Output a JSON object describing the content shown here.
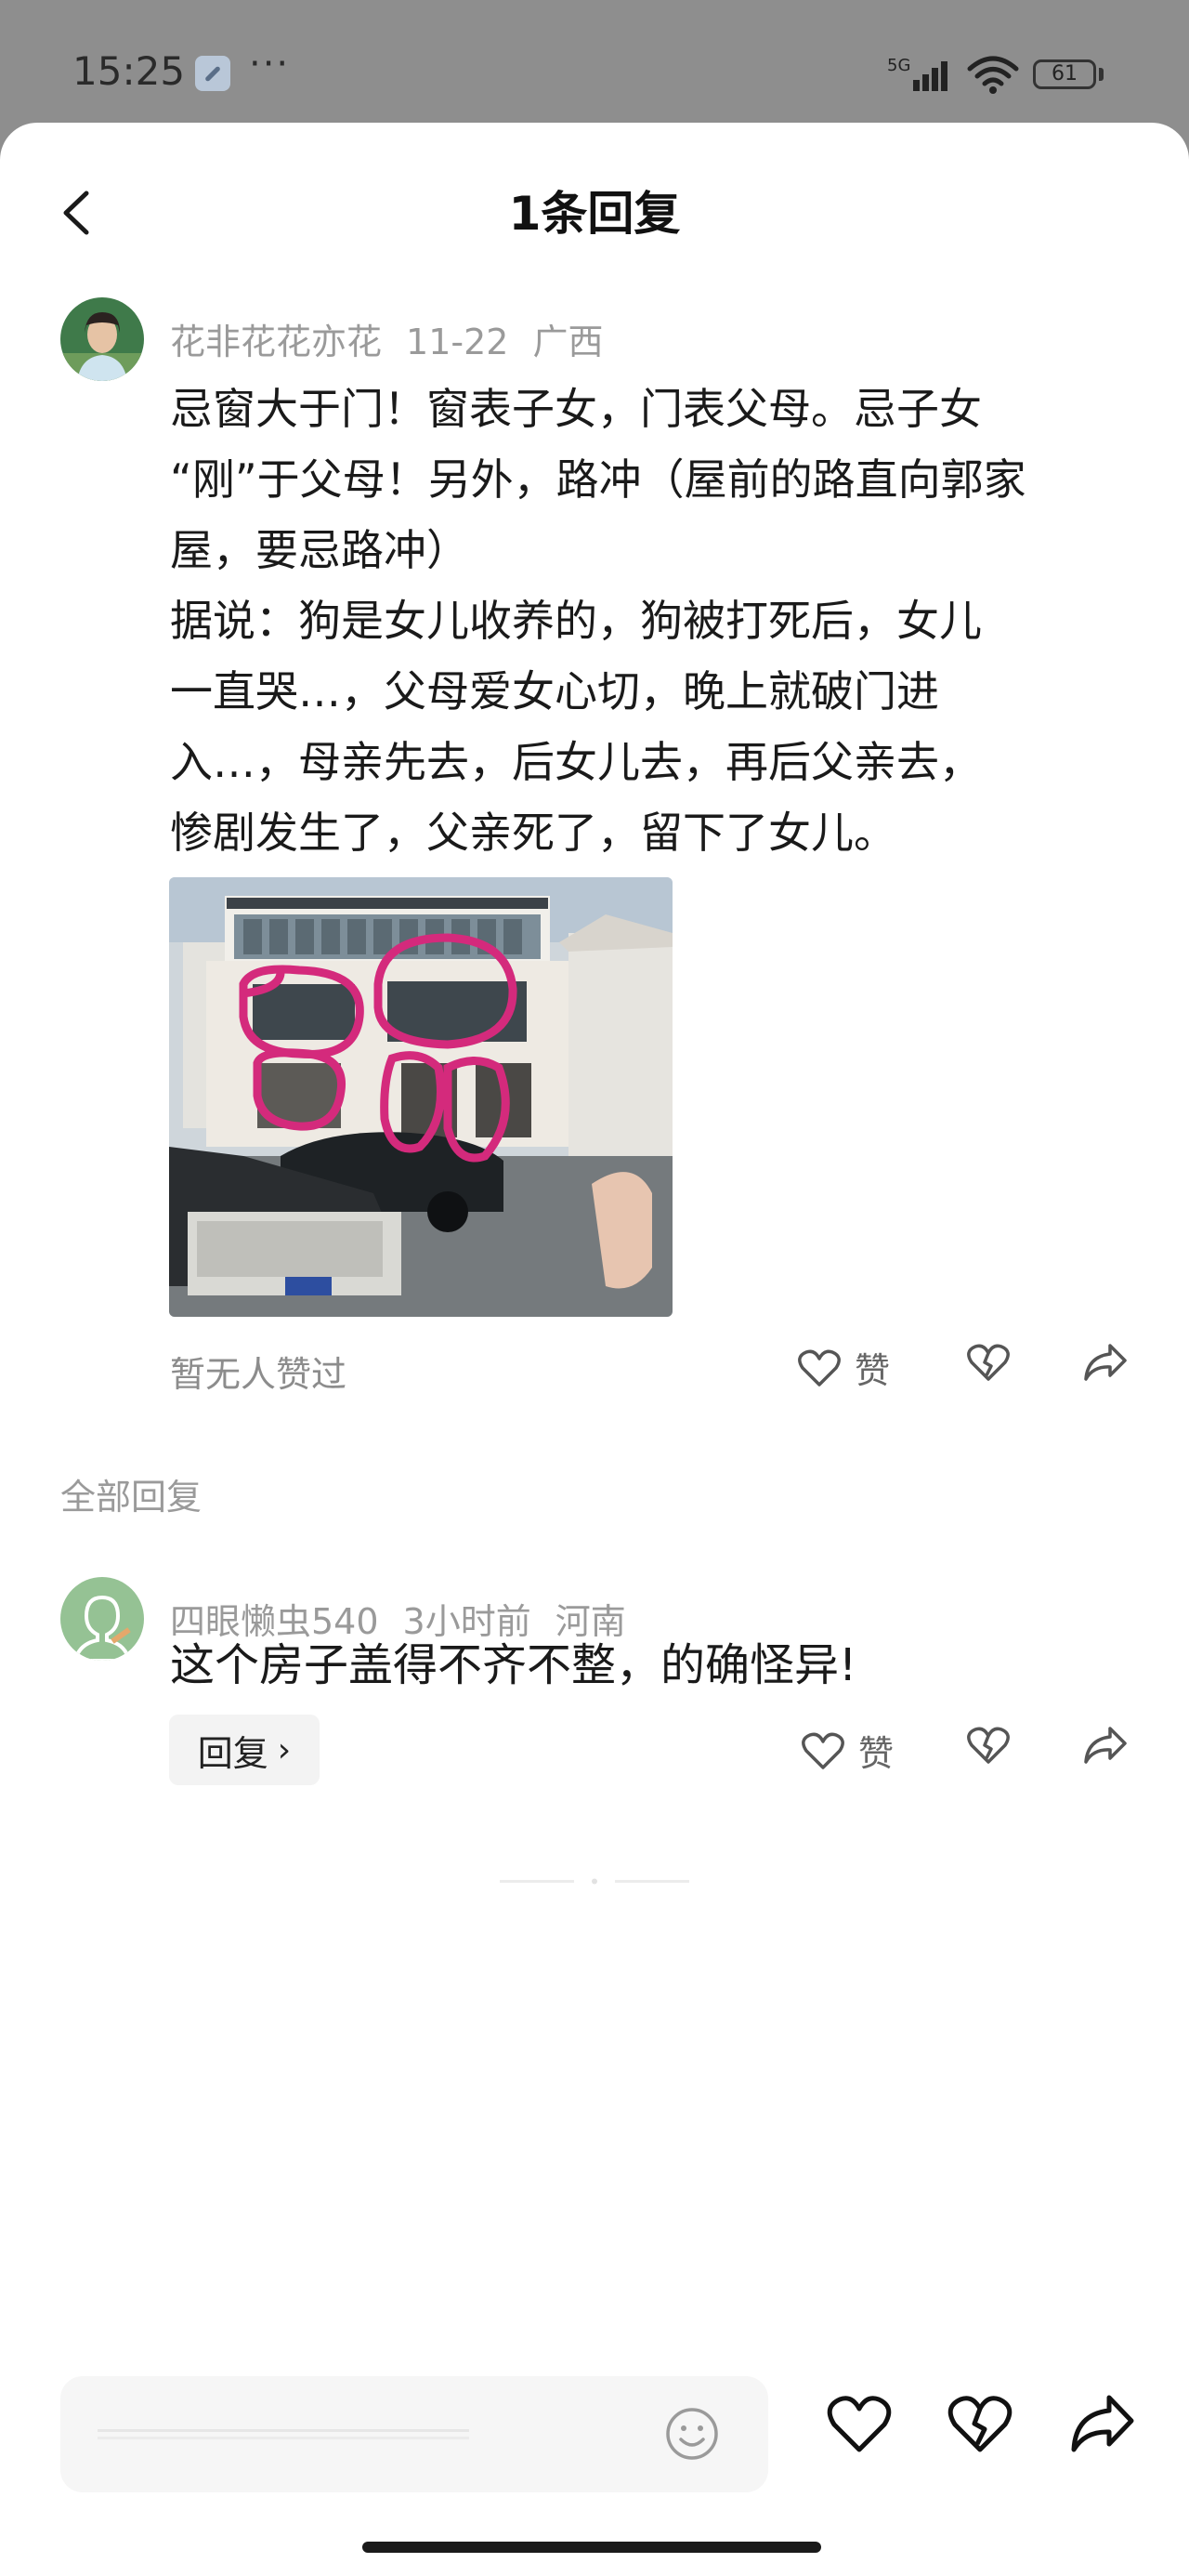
{
  "status_bar": {
    "time": "15:25",
    "more_dots": "···",
    "network": "5G",
    "battery": "61",
    "icons": [
      "wrench-icon",
      "signal-icon",
      "wifi-icon",
      "battery-icon"
    ]
  },
  "header": {
    "title": "1条回复",
    "back_icon": "chevron-left-icon"
  },
  "comment": {
    "author": "花非花花亦花",
    "date": "11-22",
    "location": "广西",
    "text": "忌窗大于门！窗表子女，门表父母。忌子女\n“刚”于父母！另外，路冲（屋前的路直向郭家\n屋，要忌路冲）\n据说：狗是女儿收养的，狗被打死后，女儿\n一直哭…，父母爱女心切，晚上就破门进\n入…，母亲先去，后女儿去，再后父亲去，\n惨剧发生了，父亲死了，留下了女儿。",
    "no_likes": "暂无人赞过",
    "like_label": "赞"
  },
  "replies_section": {
    "label": "全部回复"
  },
  "replies": [
    {
      "author": "四眼懒虫540",
      "time": "3小时前",
      "location": "河南",
      "text": "这个房子盖得不齐不整，的确怪异!",
      "reply_button": "回复",
      "like_label": "赞"
    }
  ],
  "colors": {
    "background_dim": "#8e8e8e",
    "sheet": "#ffffff",
    "meta_text": "#9a9a9a",
    "body_text": "#1a1a1a",
    "photo_marker": "#d42a7c"
  }
}
